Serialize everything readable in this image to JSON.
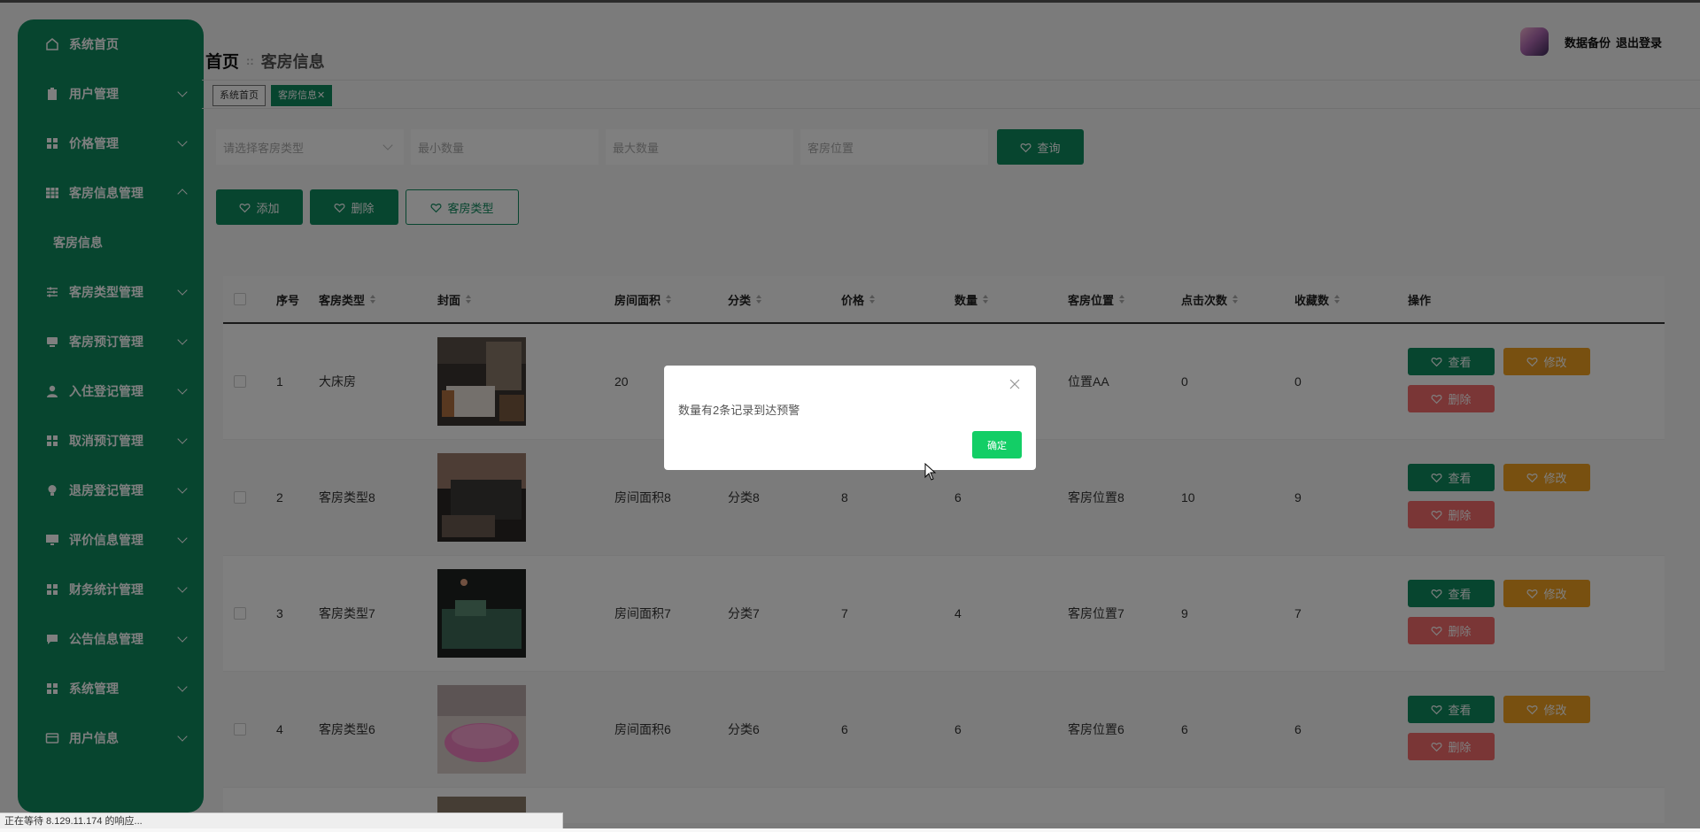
{
  "sidebar": {
    "items": [
      {
        "label": "系统首页",
        "icon": "home-icon",
        "expandable": false
      },
      {
        "label": "用户管理",
        "icon": "clipboard-icon",
        "expandable": true
      },
      {
        "label": "价格管理",
        "icon": "grid-icon",
        "expandable": true
      },
      {
        "label": "客房信息管理",
        "icon": "table-icon",
        "expandable": true,
        "expanded": true
      },
      {
        "label": "客房类型管理",
        "icon": "sliders-icon",
        "expandable": true
      },
      {
        "label": "客房预订管理",
        "icon": "device-icon",
        "expandable": true
      },
      {
        "label": "入住登记管理",
        "icon": "user-icon",
        "expandable": true
      },
      {
        "label": "取消预订管理",
        "icon": "grid-icon",
        "expandable": true
      },
      {
        "label": "退房登记管理",
        "icon": "bulb-icon",
        "expandable": true
      },
      {
        "label": "评价信息管理",
        "icon": "monitor-icon",
        "expandable": true
      },
      {
        "label": "财务统计管理",
        "icon": "grid-icon",
        "expandable": true
      },
      {
        "label": "公告信息管理",
        "icon": "chat-icon",
        "expandable": true
      },
      {
        "label": "系统管理",
        "icon": "grid-icon",
        "expandable": true
      },
      {
        "label": "用户信息",
        "icon": "card-icon",
        "expandable": true
      }
    ],
    "submenu_label": "客房信息"
  },
  "header": {
    "breadcrumb_home": "首页",
    "breadcrumb_current": "客房信息",
    "backup_label": "数据备份",
    "logout_label": "退出登录"
  },
  "tags": {
    "home": "系统首页",
    "current": "客房信息",
    "close_symbol": "✕"
  },
  "search": {
    "type_placeholder": "请选择客房类型",
    "min_placeholder": "最小数量",
    "max_placeholder": "最大数量",
    "location_placeholder": "客房位置",
    "query_label": "查询"
  },
  "actions": {
    "add": "添加",
    "delete": "删除",
    "room_type": "客房类型"
  },
  "table": {
    "headers": {
      "index": "序号",
      "type": "客房类型",
      "cover": "封面",
      "area": "房间面积",
      "category": "分类",
      "price": "价格",
      "quantity": "数量",
      "location": "客房位置",
      "clicks": "点击次数",
      "favorites": "收藏数",
      "ops": "操作"
    },
    "rows": [
      {
        "index": "1",
        "type": "大床房",
        "area": "20",
        "category": "",
        "price": "",
        "quantity": "",
        "location": "位置AA",
        "clicks": "0",
        "favorites": "0"
      },
      {
        "index": "2",
        "type": "客房类型8",
        "area": "房间面积8",
        "category": "分类8",
        "price": "8",
        "quantity": "6",
        "location": "客房位置8",
        "clicks": "10",
        "favorites": "9"
      },
      {
        "index": "3",
        "type": "客房类型7",
        "area": "房间面积7",
        "category": "分类7",
        "price": "7",
        "quantity": "4",
        "location": "客房位置7",
        "clicks": "9",
        "favorites": "7"
      },
      {
        "index": "4",
        "type": "客房类型6",
        "area": "房间面积6",
        "category": "分类6",
        "price": "6",
        "quantity": "6",
        "location": "客房位置6",
        "clicks": "6",
        "favorites": "6"
      }
    ],
    "op_labels": {
      "view": "查看",
      "edit": "修改",
      "delete": "删除"
    }
  },
  "dialog": {
    "message": "数量有2条记录到达预警",
    "confirm": "确定"
  },
  "statusbar": {
    "text": "正在等待 8.129.11.174 的响应..."
  },
  "colors": {
    "primary": "#0f8a5f",
    "warning": "#f0a020",
    "danger": "#f56c6c",
    "confirm": "#13ce66"
  }
}
